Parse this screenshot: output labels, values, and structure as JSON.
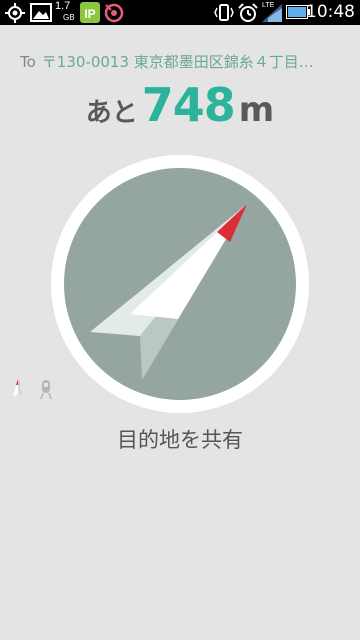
{
  "status_bar": {
    "time": "10:48",
    "data_usage": "1.7",
    "data_usage_unit": "GB",
    "network_type": "LTE",
    "icons": [
      "gps-icon",
      "gallery-icon",
      "data-usage-icon",
      "ip-icon",
      "app-notification-icon",
      "vibrate-icon",
      "alarm-icon",
      "wifi-icon",
      "signal-icon",
      "battery-icon"
    ]
  },
  "destination": {
    "prefix": "To",
    "address": "〒130-0013 東京都墨田区錦糸４丁目…"
  },
  "distance": {
    "prefix": "あと",
    "value": "748",
    "unit": "m"
  },
  "compass": {
    "ring_color": "#ffffff",
    "face_color": "#95a5a2",
    "needle_tip_color": "#dd2d38"
  },
  "mode_icons": [
    "walk-mode-icon",
    "transit-mode-icon"
  ],
  "share_label": "目的地を共有"
}
